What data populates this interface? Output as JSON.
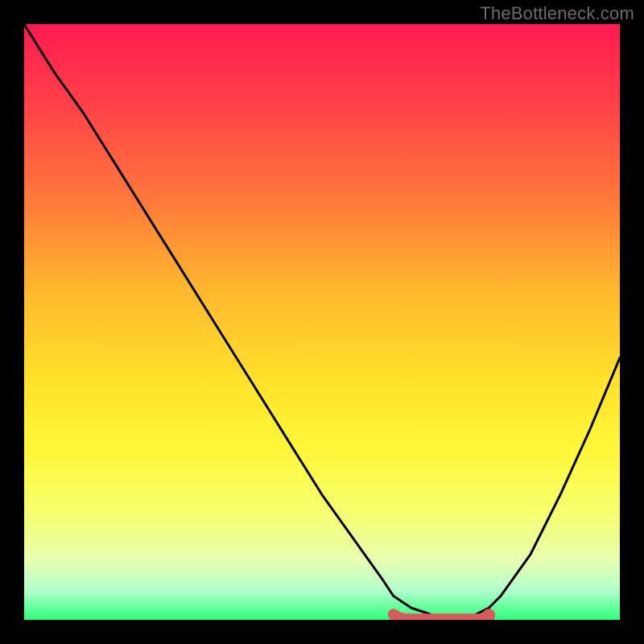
{
  "watermark": "TheBottleneck.com",
  "colors": {
    "frame": "#000000",
    "curve": "#000000",
    "highlight_fill": "#d95a5a",
    "highlight_stroke": "#d95a5a",
    "gradient_top": "#ff1a51",
    "gradient_bottom": "#2dff7a"
  },
  "chart_data": {
    "type": "line",
    "title": "",
    "xlabel": "",
    "ylabel": "",
    "xlim": [
      0,
      100
    ],
    "ylim": [
      0,
      100
    ],
    "grid": false,
    "legend_position": "none",
    "notes": "y is the bottleneck percentage; x is an unlabeled parameter axis. Values below are estimated from the plotted curve against the vertical gradient scale (top≈100, bottom≈0).",
    "x": [
      0,
      5,
      10,
      15,
      20,
      25,
      30,
      35,
      40,
      45,
      50,
      55,
      60,
      62,
      65,
      68,
      70,
      72,
      74,
      76,
      78,
      80,
      85,
      90,
      95,
      100
    ],
    "values": [
      100,
      92,
      85,
      77,
      69,
      61,
      53,
      45,
      37,
      29,
      21,
      14,
      7,
      4,
      2,
      1,
      0,
      0,
      0,
      1,
      2,
      4,
      11,
      21,
      32,
      44
    ],
    "highlight_region": {
      "description": "Flat optimum zone near the bottom drawn as a thick rounded red segment ending in a dot.",
      "x_start": 62,
      "x_end": 78,
      "y": 0.5
    }
  }
}
